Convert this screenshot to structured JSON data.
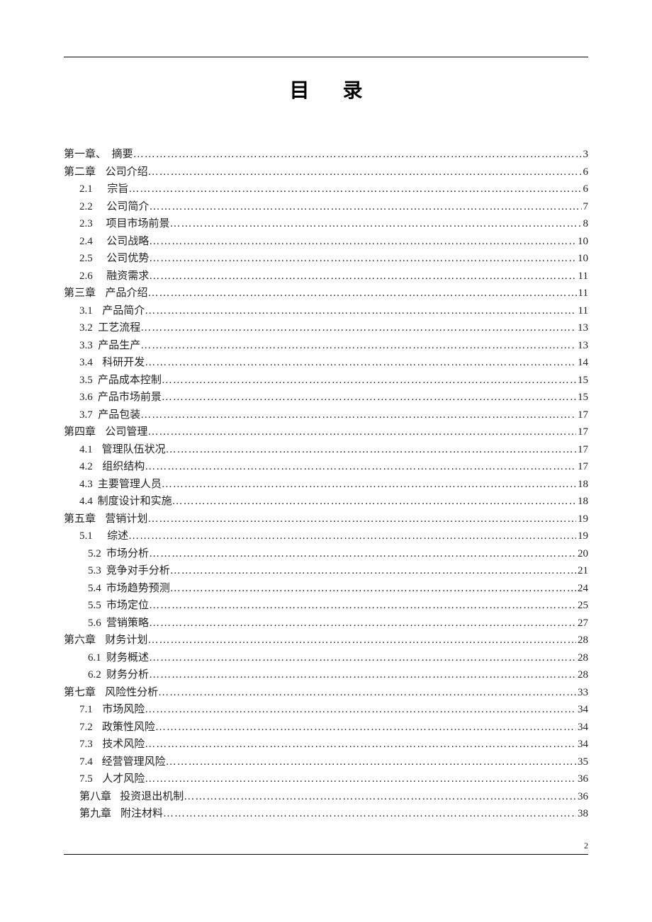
{
  "title": "目 录",
  "pageNumber": "2",
  "toc": [
    {
      "indent": 0,
      "label": "第一章、",
      "gap": "sm",
      "text": "摘要",
      "page": "3"
    },
    {
      "indent": 0,
      "label": "第二章",
      "gap": "md",
      "text": "公司介绍",
      "page": "6"
    },
    {
      "indent": 1,
      "label": "2.1",
      "gap": "lg",
      "text": "宗旨",
      "page": "6"
    },
    {
      "indent": 1,
      "label": "2.2",
      "gap": "lg",
      "text": "公司简介",
      "page": "7"
    },
    {
      "indent": 1,
      "label": "2.3",
      "gap": "lg",
      "text": "项目市场前景",
      "page": "8"
    },
    {
      "indent": 1,
      "label": "2.4",
      "gap": "lg",
      "text": "公司战略",
      "page": "10"
    },
    {
      "indent": 1,
      "label": "2.5",
      "gap": "lg",
      "text": "公司优势",
      "page": "10"
    },
    {
      "indent": 1,
      "label": "2.6",
      "gap": "lg",
      "text": "融资需求",
      "page": "11"
    },
    {
      "indent": 0,
      "label": "第三章",
      "gap": "md",
      "text": "产品介绍",
      "page": "11"
    },
    {
      "indent": 1,
      "label": "3.1",
      "gap": "md",
      "text": "产品简介",
      "page": "11"
    },
    {
      "indent": 1,
      "label": "3.2",
      "gap": "sm",
      "text": "工艺流程",
      "page": "13"
    },
    {
      "indent": 1,
      "label": "3.3",
      "gap": "sm",
      "text": "产品生产",
      "page": "13"
    },
    {
      "indent": 1,
      "label": "3.4",
      "gap": "md",
      "text": "科研开发",
      "page": "14"
    },
    {
      "indent": 1,
      "label": "3.5",
      "gap": "sm",
      "text": "产品成本控制",
      "page": "15"
    },
    {
      "indent": 1,
      "label": "3.6",
      "gap": "sm",
      "text": "产品市场前景",
      "page": "15"
    },
    {
      "indent": 1,
      "label": "3.7",
      "gap": "sm",
      "text": "产品包装",
      "page": "17"
    },
    {
      "indent": 0,
      "label": "第四章",
      "gap": "md",
      "text": "公司管理",
      "page": "17"
    },
    {
      "indent": 1,
      "label": "4.1",
      "gap": "md",
      "text": "管理队伍状况",
      "page": "17"
    },
    {
      "indent": 1,
      "label": "4.2",
      "gap": "md",
      "text": "组织结构",
      "page": "17"
    },
    {
      "indent": 1,
      "label": "4.3",
      "gap": "sm",
      "text": "主要管理人员",
      "page": "18"
    },
    {
      "indent": 1,
      "label": "4.4",
      "gap": "sm",
      "text": "制度设计和实施",
      "page": "18"
    },
    {
      "indent": 0,
      "label": "第五章",
      "gap": "md",
      "text": "营销计划",
      "page": "19"
    },
    {
      "indent": 1,
      "label": "5.1",
      "gap": "lg",
      "text": "综述",
      "page": "19"
    },
    {
      "indent": 2,
      "label": "5.2",
      "gap": "sm",
      "text": "市场分析",
      "page": "20"
    },
    {
      "indent": 2,
      "label": "5.3",
      "gap": "sm",
      "text": "竞争对手分析",
      "page": "21"
    },
    {
      "indent": 2,
      "label": "5.4",
      "gap": "sm",
      "text": "市场趋势预测",
      "page": "24"
    },
    {
      "indent": 2,
      "label": "5.5",
      "gap": "sm",
      "text": "市场定位",
      "page": "25"
    },
    {
      "indent": 2,
      "label": "5.6",
      "gap": "sm",
      "text": "营销策略",
      "page": "27"
    },
    {
      "indent": 0,
      "label": "第六章",
      "gap": "md",
      "text": "财务计划",
      "page": "28"
    },
    {
      "indent": 2,
      "label": "6.1",
      "gap": "sm",
      "text": "财务概述",
      "page": "28"
    },
    {
      "indent": 2,
      "label": "6.2",
      "gap": "sm",
      "text": "财务分析",
      "page": "28"
    },
    {
      "indent": 0,
      "label": "第七章",
      "gap": "md",
      "text": "风险性分析",
      "page": "33"
    },
    {
      "indent": 1,
      "label": "7.1",
      "gap": "md",
      "text": "市场风险",
      "page": "34"
    },
    {
      "indent": 1,
      "label": "7.2",
      "gap": "md",
      "text": "政策性风险",
      "page": "34"
    },
    {
      "indent": 1,
      "label": "7.3",
      "gap": "md",
      "text": "技术风险",
      "page": "34"
    },
    {
      "indent": 1,
      "label": "7.4",
      "gap": "md",
      "text": "经营管理风险",
      "page": "35"
    },
    {
      "indent": 1,
      "label": "7.5",
      "gap": "md",
      "text": "人才风险",
      "page": "36"
    },
    {
      "indent": 1,
      "label": "第八章",
      "gap": "md",
      "text": "投资退出机制",
      "page": "36"
    },
    {
      "indent": 1,
      "label": "第九章",
      "gap": "md",
      "text": "附注材料",
      "page": "38"
    }
  ]
}
